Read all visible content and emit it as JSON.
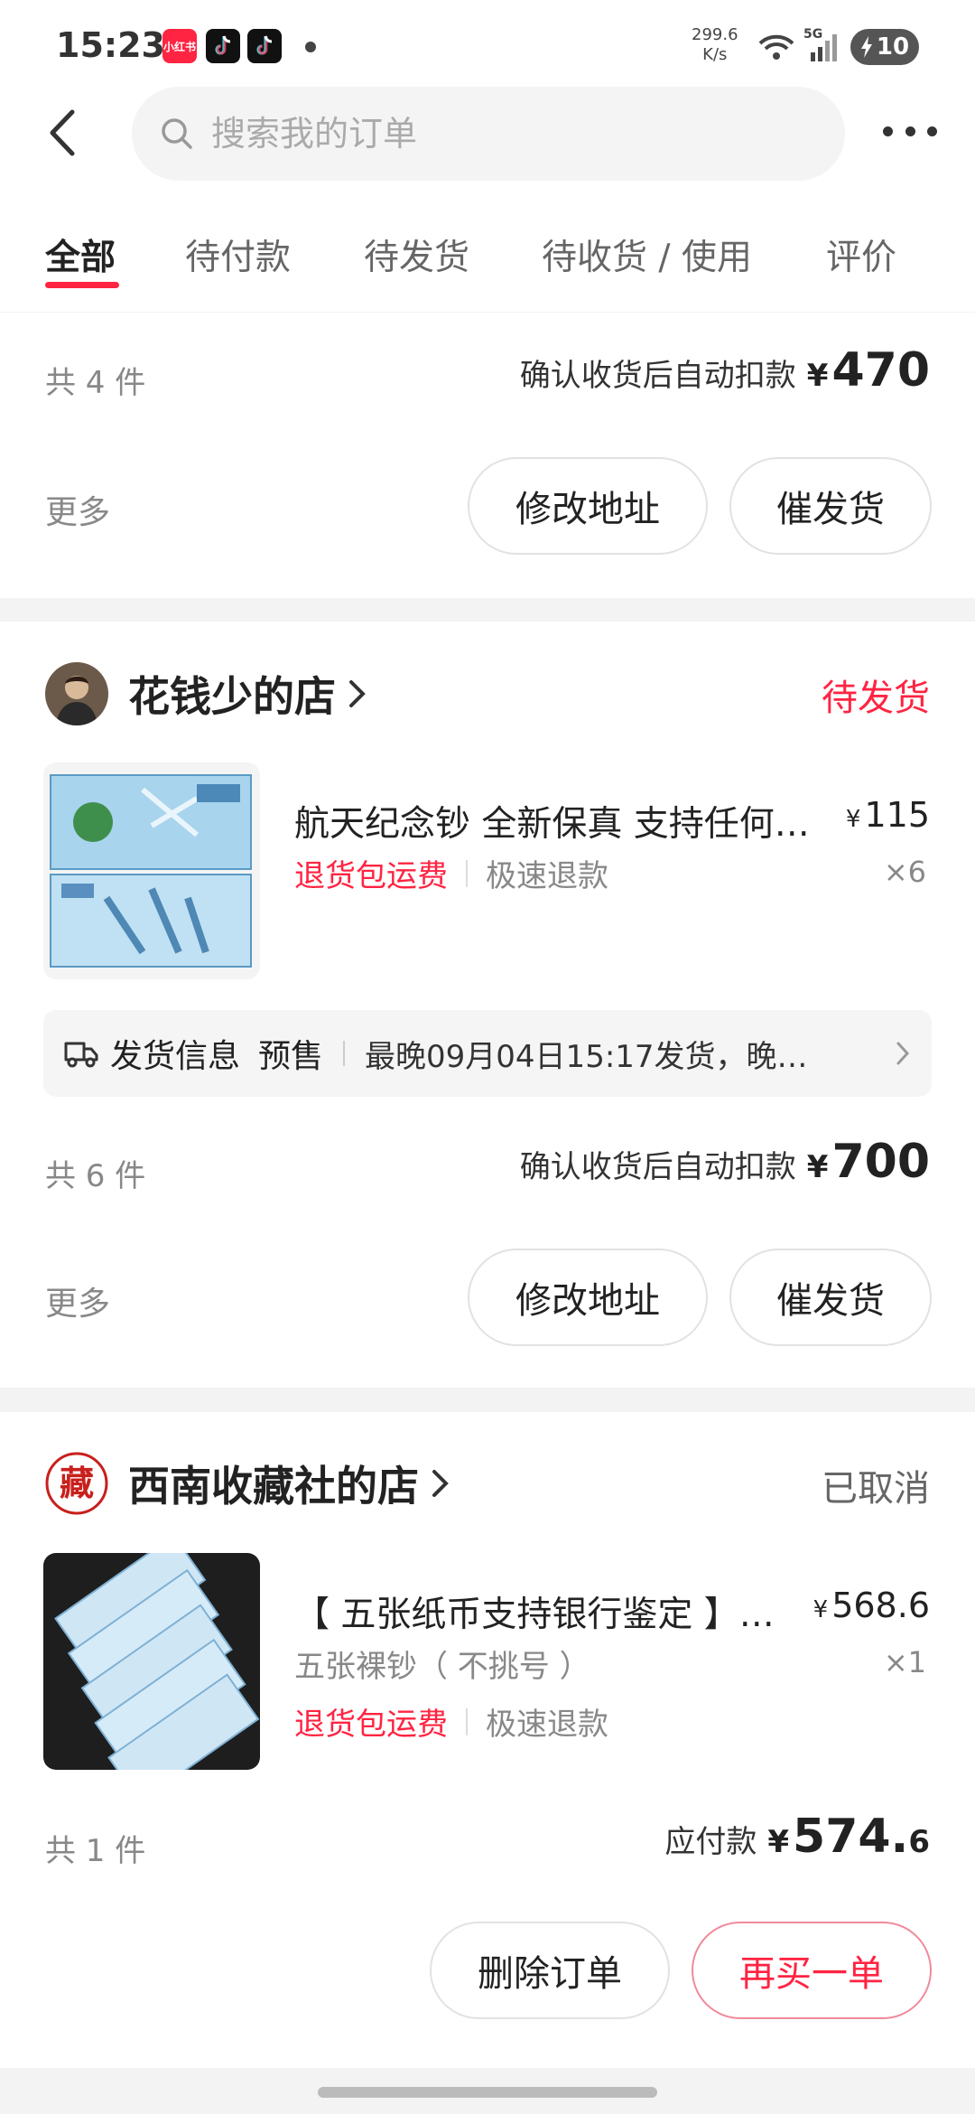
{
  "status_bar": {
    "time": "15:23",
    "apps": [
      "小红书",
      "tiktok",
      "tiktok"
    ],
    "net_speed_value": "299.6",
    "net_speed_unit": "K/s",
    "network": "5G",
    "battery": "10"
  },
  "search": {
    "placeholder": "搜索我的订单"
  },
  "tabs": [
    {
      "label": "全部",
      "active": true
    },
    {
      "label": "待付款"
    },
    {
      "label": "待发货"
    },
    {
      "label": "待收货 / 使用"
    },
    {
      "label": "评价"
    }
  ],
  "orders": [
    {
      "count_text": "共 4 件",
      "pay_label": "确认收货后自动扣款",
      "currency": "¥",
      "amount": "470",
      "more": "更多",
      "buttons": [
        "修改地址",
        "催发货"
      ]
    },
    {
      "shop_name": "花钱少的店",
      "status": "待发货",
      "status_color": "#ff2442",
      "product": {
        "title": "航天纪念钞 全新保真 支持任何…",
        "price": "115",
        "tag_red": "退货包运费",
        "tag_grey": "极速退款",
        "qty": "×6"
      },
      "shipping": {
        "label": "发货信息",
        "type": "预售",
        "info": "最晚09月04日15:17发货，晚…"
      },
      "count_text": "共 6 件",
      "pay_label": "确认收货后自动扣款",
      "currency": "¥",
      "amount": "700",
      "more": "更多",
      "buttons": [
        "修改地址",
        "催发货"
      ]
    },
    {
      "shop_name": "西南收藏社的店",
      "shop_logo_text": "藏",
      "status": "已取消",
      "status_color": "#666666",
      "product": {
        "title": "【 五张纸币支持银行鉴定 】…",
        "price": "568.6",
        "spec": "五张裸钞（ 不挑号 ）",
        "tag_red": "退货包运费",
        "tag_grey": "极速退款",
        "qty": "×1"
      },
      "count_text": "共 1 件",
      "pay_label": "应付款",
      "currency": "¥",
      "amount": "574.",
      "amount_decimal": "6",
      "buttons": [
        "删除订单",
        "再买一单"
      ]
    }
  ],
  "colors": {
    "accent": "#ff2442",
    "background": "#f3f3f3"
  }
}
